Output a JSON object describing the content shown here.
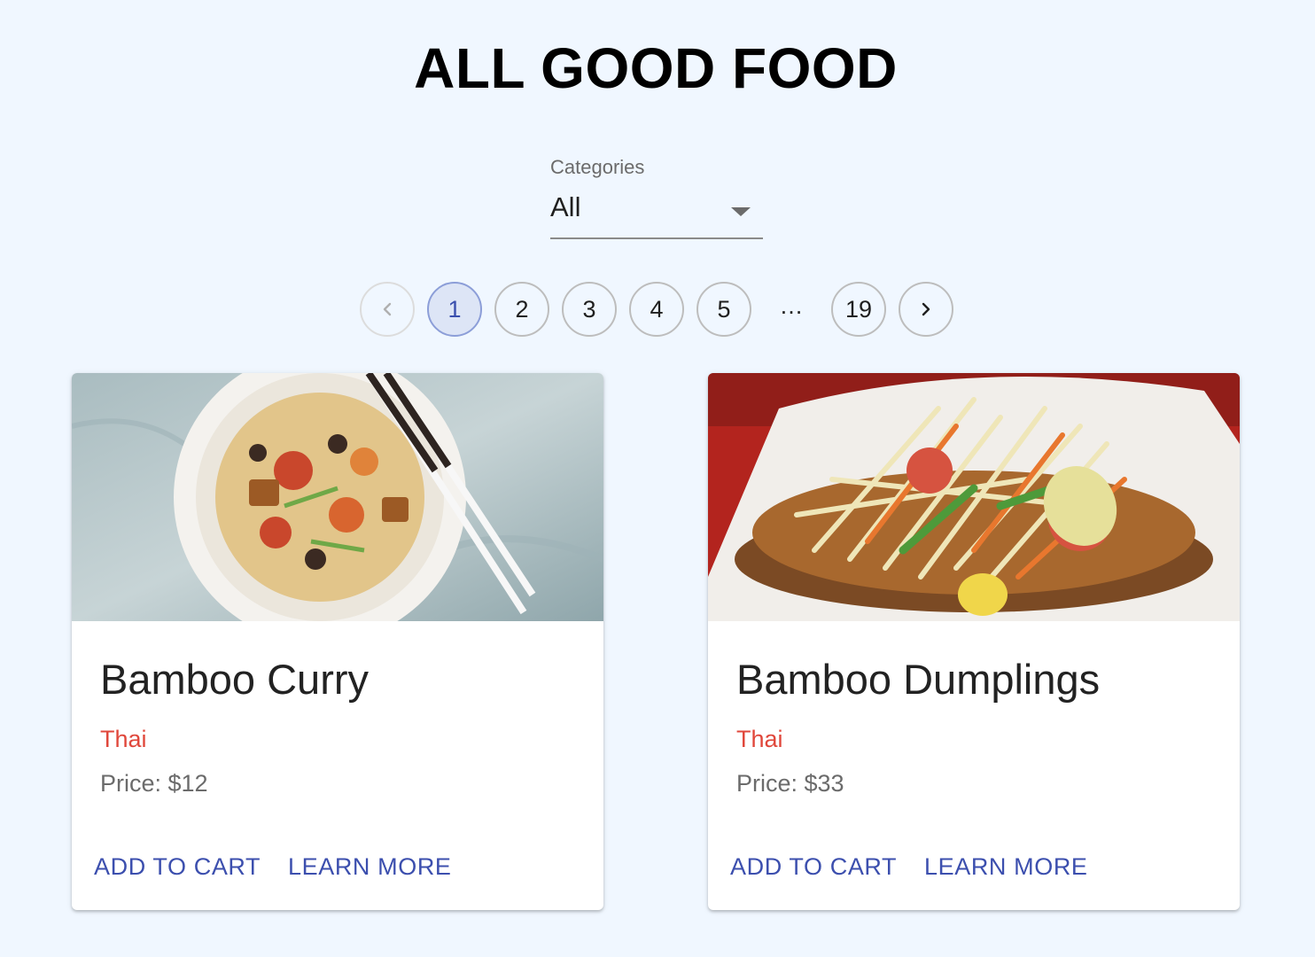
{
  "page": {
    "title": "ALL GOOD FOOD"
  },
  "filter": {
    "label": "Categories",
    "selected": "All"
  },
  "pagination": {
    "current": 1,
    "pages": [
      "1",
      "2",
      "3",
      "4",
      "5"
    ],
    "ellipsis": "…",
    "last": "19",
    "prev_icon": "chevron-left-icon",
    "next_icon": "chevron-right-icon"
  },
  "products": [
    {
      "name": "Bamboo Curry",
      "category": "Thai",
      "price": "Price: $12",
      "add_label": "ADD TO CART",
      "learn_label": "LEARN MORE",
      "image": "pad-thai-noodle-bowl-image"
    },
    {
      "name": "Bamboo Dumplings",
      "category": "Thai",
      "price": "Price: $33",
      "add_label": "ADD TO CART",
      "learn_label": "LEARN MORE",
      "image": "papaya-salad-plate-image"
    }
  ],
  "colors": {
    "background": "#f0f7ff",
    "accent": "#3c4fae",
    "category": "#e0473b",
    "active_page_bg": "#dde5f6"
  }
}
